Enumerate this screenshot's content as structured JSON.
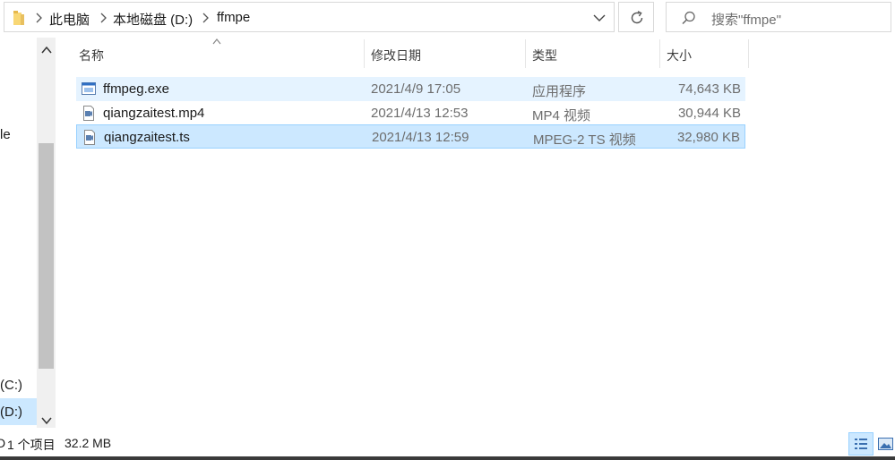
{
  "breadcrumb": {
    "items": [
      "此电脑",
      "本地磁盘 (D:)",
      "ffmpe"
    ]
  },
  "search": {
    "placeholder": "搜索\"ffmpe\""
  },
  "nav": {
    "partial_label_top": "le",
    "drive_c": "(C:)",
    "drive_d": "(D:)"
  },
  "columns": {
    "name": "名称",
    "date": "修改日期",
    "type": "类型",
    "size": "大小"
  },
  "files": [
    {
      "name": "ffmpeg.exe",
      "date": "2021/4/9 17:05",
      "type": "应用程序",
      "size": "74,643 KB",
      "icon": "application-exe-icon",
      "state": "hover"
    },
    {
      "name": "qiangzaitest.mp4",
      "date": "2021/4/13 12:53",
      "type": "MP4 视频",
      "size": "30,944 KB",
      "icon": "video-file-icon",
      "state": "normal"
    },
    {
      "name": "qiangzaitest.ts",
      "date": "2021/4/13 12:59",
      "type": "MPEG-2 TS 视频",
      "size": "32,980 KB",
      "icon": "video-file-icon",
      "state": "selected"
    }
  ],
  "status": {
    "items_prefix": "D",
    "selected": "1 个项目",
    "size": "32.2 MB"
  },
  "colors": {
    "selection_bg": "#cce8ff",
    "selection_border": "#99d1ff",
    "hover_bg": "#e5f3ff",
    "folder_yellow": "#f8d775"
  }
}
